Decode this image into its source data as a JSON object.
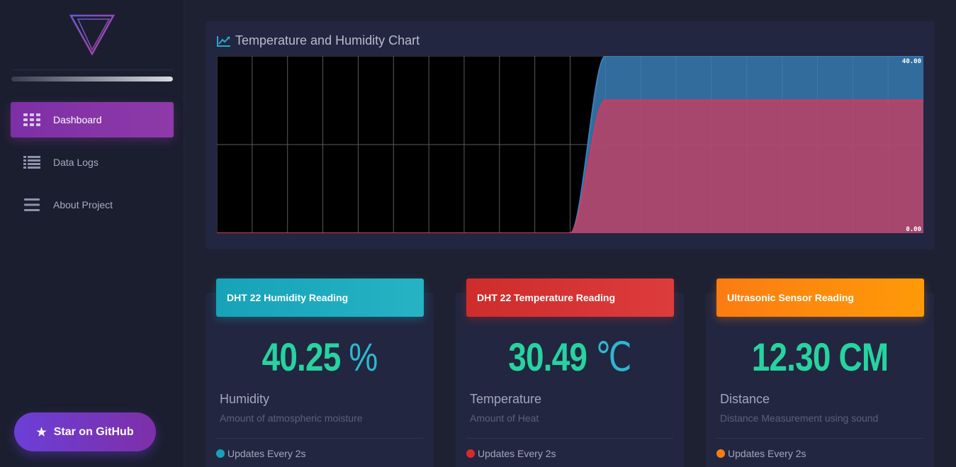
{
  "sidebar": {
    "logo_icon": "triangle-logo-icon",
    "progress_fraction": 1.0,
    "items": [
      {
        "label": "Dashboard",
        "icon": "grid-icon",
        "active": true
      },
      {
        "label": "Data Logs",
        "icon": "list-icon",
        "active": false
      },
      {
        "label": "About Project",
        "icon": "menu-icon",
        "active": false
      }
    ],
    "github_button": {
      "label": "Star on GitHub",
      "icon": "star-icon"
    }
  },
  "chart_panel": {
    "title": "Temperature and Humidity Chart",
    "icon": "line-chart-icon"
  },
  "chart_data": {
    "type": "area",
    "ylim": [
      0,
      40
    ],
    "y_tick_labels": [
      "40.00",
      "0.00"
    ],
    "grid": true,
    "x": [
      0,
      1,
      2,
      3,
      4,
      5,
      6,
      7,
      8,
      9,
      10,
      11,
      12,
      13,
      14,
      15,
      16,
      17,
      18,
      19,
      20
    ],
    "series": [
      {
        "color": "#3b7fb8",
        "values": [
          0,
          0,
          0,
          0,
          0,
          0,
          0,
          0,
          0,
          0,
          0,
          40,
          40,
          40,
          40,
          40,
          40,
          40,
          40,
          40,
          40
        ]
      },
      {
        "color": "#d9375a",
        "values": [
          0,
          0,
          0,
          0,
          0,
          0,
          0,
          0,
          0,
          0,
          0,
          30,
          30,
          30,
          30,
          30,
          30,
          30,
          30,
          30,
          30
        ]
      }
    ]
  },
  "cards": [
    {
      "header": "DHT 22 Humidity Reading",
      "value": "40.25",
      "unit": " %",
      "label": "Humidity",
      "description": "Amount of atmospheric moisture",
      "footer": "Updates Every 2s",
      "header_gradient": [
        "#17a2b8",
        "#26b3c4"
      ],
      "dot_color": "#17a2b8"
    },
    {
      "header": "DHT 22 Temperature Reading",
      "value": "30.49",
      "unit": " ℃",
      "label": "Temperature",
      "description": "Amount of Heat",
      "footer": "Updates Every 2s",
      "header_gradient": [
        "#cf2c2c",
        "#dd3c3c"
      ],
      "dot_color": "#d42c2c"
    },
    {
      "header": "Ultrasonic Sensor Reading",
      "value": "12.30 CM",
      "unit": "",
      "label": "Distance",
      "description": "Distance Measurement using sound",
      "footer": "Updates Every 2s",
      "header_gradient": [
        "#fb7c12",
        "#ff9a08"
      ],
      "dot_color": "#fb7c12"
    }
  ]
}
